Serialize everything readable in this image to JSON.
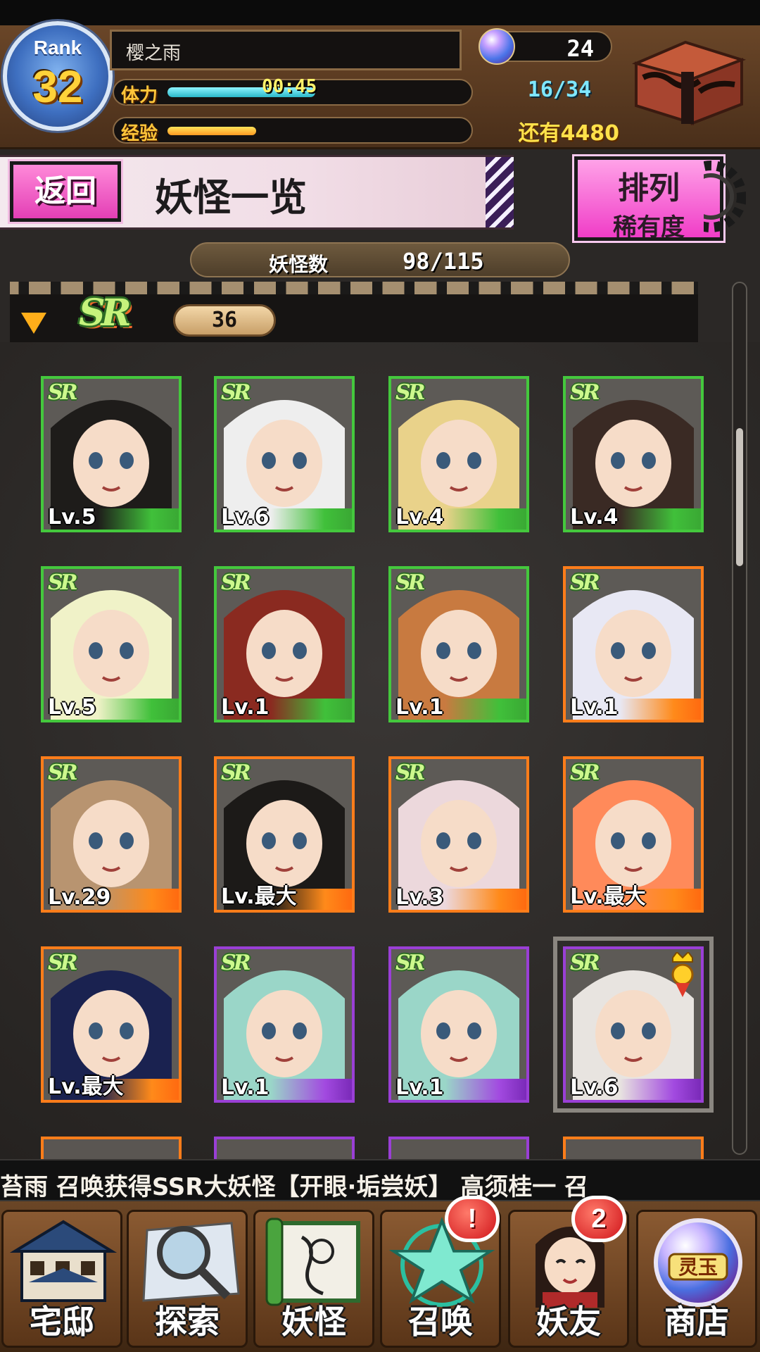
{
  "player": {
    "rank_label": "Rank",
    "rank": "32",
    "name": "樱之雨",
    "stamina_label": "体力",
    "stamina_timer": "00:45",
    "stamina_fill": 0.5,
    "exp_label": "经验",
    "exp_fill": 0.3,
    "orbs": "24",
    "stamina_count": "16/34",
    "exp_remaining": "还有4480"
  },
  "header": {
    "back_label": "返回",
    "title": "妖怪一览",
    "sort_label": "排列",
    "sort_value": "稀有度"
  },
  "collection": {
    "count_label": "妖怪数",
    "count_value": "98/115"
  },
  "group": {
    "rarity": "SR",
    "count": "36"
  },
  "cards": [
    {
      "rarity": "SR",
      "level": "Lv.5",
      "frame": "green"
    },
    {
      "rarity": "SR",
      "level": "Lv.6",
      "frame": "green"
    },
    {
      "rarity": "SR",
      "level": "Lv.4",
      "frame": "green"
    },
    {
      "rarity": "SR",
      "level": "Lv.4",
      "frame": "green"
    },
    {
      "rarity": "SR",
      "level": "Lv.5",
      "frame": "green"
    },
    {
      "rarity": "SR",
      "level": "Lv.1",
      "frame": "green"
    },
    {
      "rarity": "SR",
      "level": "Lv.1",
      "frame": "green"
    },
    {
      "rarity": "SR",
      "level": "Lv.1",
      "frame": "orange"
    },
    {
      "rarity": "SR",
      "level": "Lv.29",
      "frame": "orange"
    },
    {
      "rarity": "SR",
      "level": "Lv.最大",
      "frame": "orange"
    },
    {
      "rarity": "SR",
      "level": "Lv.3",
      "frame": "orange"
    },
    {
      "rarity": "SR",
      "level": "Lv.最大",
      "frame": "orange"
    },
    {
      "rarity": "SR",
      "level": "Lv.最大",
      "frame": "orange"
    },
    {
      "rarity": "SR",
      "level": "Lv.1",
      "frame": "purple"
    },
    {
      "rarity": "SR",
      "level": "Lv.1",
      "frame": "purple"
    },
    {
      "rarity": "SR",
      "level": "Lv.6",
      "frame": "purple"
    }
  ],
  "ticker": {
    "message": "苔雨 召唤获得SSR大妖怪【开眼·垢尝妖】  高须桂一 召"
  },
  "nav": {
    "home": "宅邸",
    "explore": "探索",
    "yokai": "妖怪",
    "summon": "召唤",
    "summon_badge": "!",
    "friends": "妖友",
    "friends_badge": "2",
    "shop": "商店",
    "shop_orb_text": "灵玉"
  },
  "colors": {
    "frame_green": "#44c83d",
    "frame_orange": "#ff7d1a",
    "frame_purple": "#9a3fd6",
    "accent_pink": "#f03dc7"
  }
}
